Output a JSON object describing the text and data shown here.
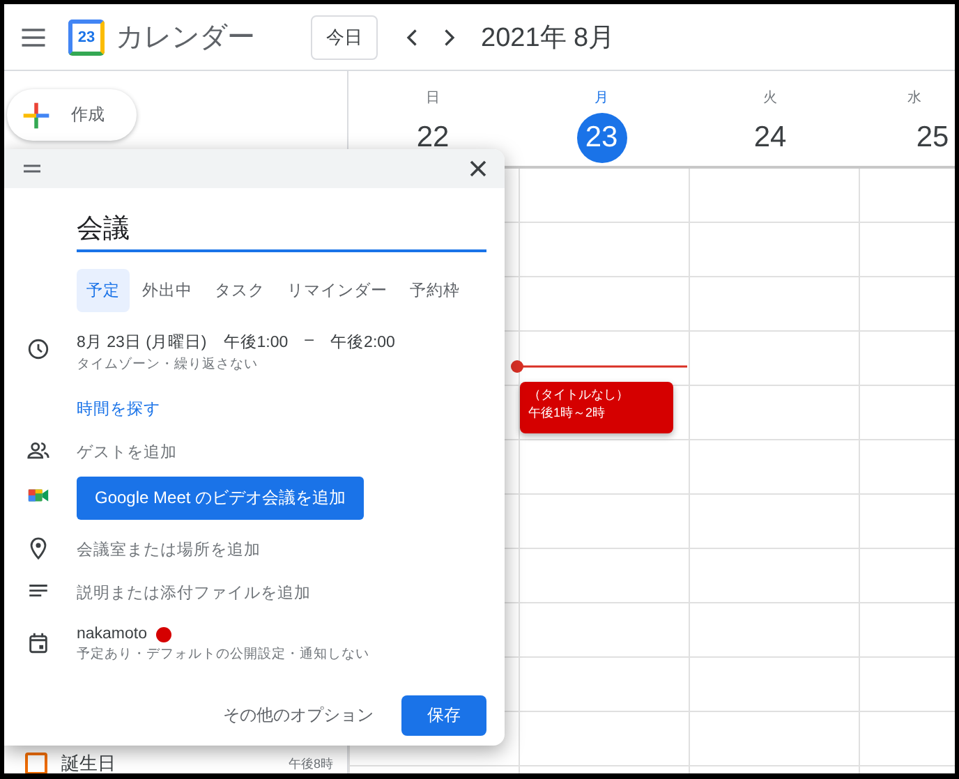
{
  "header": {
    "logo_text": "23",
    "app_name": "カレンダー",
    "today_button": "今日",
    "period": "2021年 8月"
  },
  "create_button": "作成",
  "days": [
    {
      "weekday": "日",
      "date": "22",
      "selected": false
    },
    {
      "weekday": "月",
      "date": "23",
      "selected": true
    },
    {
      "weekday": "火",
      "date": "24",
      "selected": false
    },
    {
      "weekday": "水",
      "date": "25",
      "selected": false
    }
  ],
  "time_labels": [
    "午後8時"
  ],
  "event": {
    "title": "（タイトルなし）",
    "time": "午後1時～2時"
  },
  "sidebar": {
    "calendars": [
      {
        "label": "誕生日",
        "checked": false,
        "color": "#ef6c00"
      }
    ]
  },
  "dialog": {
    "title_value": "会議",
    "tabs": [
      {
        "label": "予定",
        "selected": true
      },
      {
        "label": "外出中",
        "selected": false
      },
      {
        "label": "タスク",
        "selected": false
      },
      {
        "label": "リマインダー",
        "selected": false
      },
      {
        "label": "予約枠",
        "selected": false
      }
    ],
    "rows": [
      {
        "kind": "datetime",
        "date": "8月 23日 (月曜日)",
        "start": "午後1:00",
        "separator": "–",
        "end": "午後2:00",
        "subtext": "タイムゾーン・繰り返さない"
      },
      {
        "kind": "link",
        "text": "時間を探す"
      },
      {
        "kind": "guests",
        "text": "ゲストを追加"
      },
      {
        "kind": "meet",
        "text": "Google Meet のビデオ会議を追加"
      },
      {
        "kind": "location",
        "text": "会議室または場所を追加"
      },
      {
        "kind": "description",
        "text": "説明または添付ファイルを追加"
      },
      {
        "kind": "calendar",
        "text": "nakamoto",
        "color": "#d50000",
        "subtext": "予定あり・デフォルトの公開設定・通知しない"
      }
    ],
    "more_options": "その他のオプション",
    "save_button": "保存"
  }
}
